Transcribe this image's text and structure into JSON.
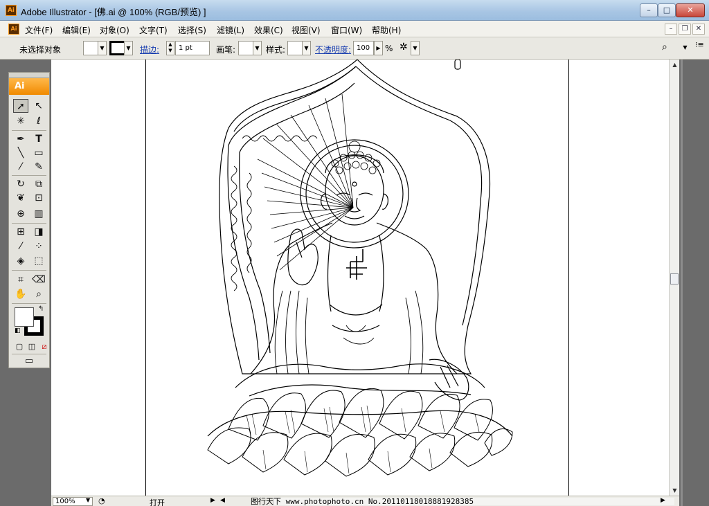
{
  "window": {
    "title": "Adobe Illustrator - [佛.ai @ 100% (RGB/预览) ]",
    "app_icon": "Ai",
    "controls": {
      "minimize": "–",
      "restore": "□",
      "close": "✕"
    }
  },
  "menubar": {
    "items": [
      "文件(F)",
      "编辑(E)",
      "对象(O)",
      "文字(T)",
      "选择(S)",
      "滤镜(L)",
      "效果(C)",
      "视图(V)",
      "窗口(W)",
      "帮助(H)"
    ],
    "doc_icon": "Ai"
  },
  "controlbar": {
    "selection_status": "未选择对象",
    "stroke_label": "描边:",
    "stroke_weight": "1 pt",
    "brush_label": "画笔:",
    "style_label": "样式:",
    "opacity_label": "不透明度:",
    "opacity_value": "100",
    "opacity_unit": "%"
  },
  "toolpanel": {
    "header": "Ai",
    "icons": [
      "selection-tool",
      "direct-selection-tool",
      "magic-wand-tool",
      "lasso-tool",
      "pen-tool",
      "type-tool",
      "line-tool",
      "rectangle-tool",
      "paintbrush-tool",
      "pencil-tool",
      "rotate-tool",
      "scale-tool",
      "warp-tool",
      "free-transform-tool",
      "symbol-sprayer-tool",
      "column-graph-tool",
      "mesh-tool",
      "gradient-tool",
      "eyedropper-tool",
      "blend-tool",
      "live-paint-bucket-tool",
      "live-paint-selection-tool",
      "slice-tool",
      "eraser-tool",
      "hand-tool",
      "zoom-tool"
    ]
  },
  "statusbar": {
    "zoom": "100%",
    "status_text": "打开"
  },
  "watermark": "图行天下 www.photophoto.cn No.20110118018881928385"
}
